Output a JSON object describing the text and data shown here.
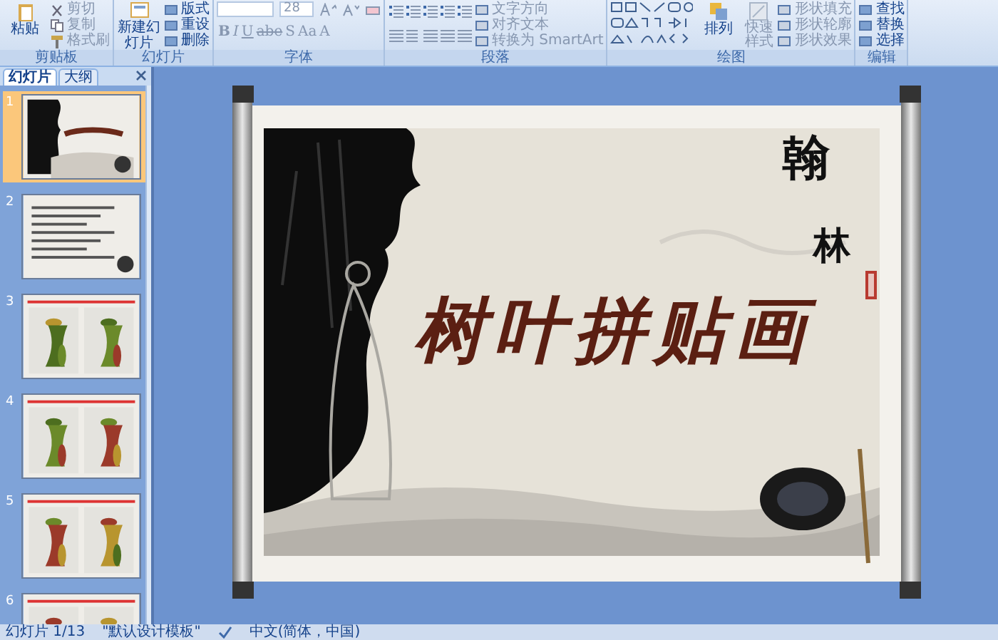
{
  "ribbon": {
    "clipboard": {
      "label": "剪贴板",
      "paste": "粘贴",
      "commands": [
        {
          "label": "剪切",
          "disabled": true
        },
        {
          "label": "复制",
          "disabled": true
        },
        {
          "label": "格式刷",
          "disabled": true
        }
      ]
    },
    "slides": {
      "label": "幻灯片",
      "new_slide": "新建幻灯片",
      "commands": [
        {
          "label": "版式",
          "disabled": false
        },
        {
          "label": "重设",
          "disabled": false
        },
        {
          "label": "删除",
          "disabled": false
        }
      ]
    },
    "font": {
      "label": "字体",
      "font_size": "28",
      "format_buttons": [
        "B",
        "I",
        "U",
        "abe",
        "S",
        "Aa",
        "A"
      ]
    },
    "paragraph": {
      "label": "段落",
      "commands": [
        {
          "label": "文字方向",
          "disabled": true
        },
        {
          "label": "对齐文本",
          "disabled": true
        },
        {
          "label": "转换为 SmartArt",
          "disabled": true
        }
      ]
    },
    "drawing": {
      "label": "绘图",
      "arrange": "排列",
      "quick_styles": "快速样式",
      "commands": [
        {
          "label": "形状填充",
          "disabled": true
        },
        {
          "label": "形状轮廓",
          "disabled": true
        },
        {
          "label": "形状效果",
          "disabled": true
        }
      ]
    },
    "editing": {
      "label": "编辑",
      "commands": [
        {
          "label": "查找",
          "disabled": false
        },
        {
          "label": "替换",
          "disabled": false
        },
        {
          "label": "选择",
          "disabled": false
        }
      ]
    }
  },
  "pane": {
    "tabs": [
      {
        "label": "幻灯片",
        "selected": true
      },
      {
        "label": "大纲",
        "selected": false
      }
    ],
    "slides": [
      {
        "number": "1",
        "selected": true
      },
      {
        "number": "2",
        "selected": false
      },
      {
        "number": "3",
        "selected": false
      },
      {
        "number": "4",
        "selected": false
      },
      {
        "number": "5",
        "selected": false
      },
      {
        "number": "6",
        "selected": false
      }
    ]
  },
  "slide": {
    "title": "树叶拼贴画",
    "vertical_text": [
      "翰",
      "林"
    ]
  },
  "status_bar": {
    "slide": "幻灯片 1/13",
    "theme": "\"默认设计模板\"",
    "language": "中文(简体，中国)"
  }
}
